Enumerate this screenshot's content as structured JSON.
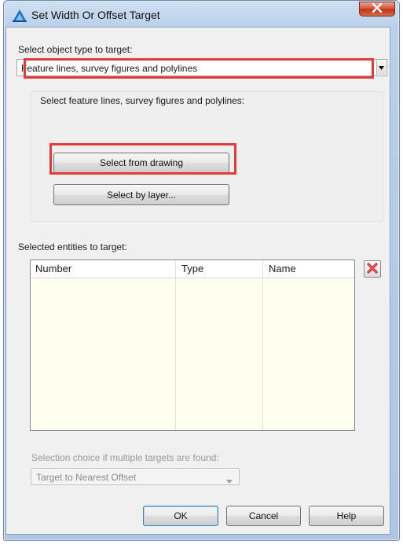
{
  "window": {
    "title": "Set Width Or Offset Target",
    "close_icon": "close-icon"
  },
  "object_type": {
    "label": "Select object type to target:",
    "selected": "Feature lines, survey figures and polylines"
  },
  "selection_group": {
    "label": "Select feature lines, survey figures and polylines:",
    "select_from_drawing": "Select from drawing",
    "select_by_layer": "Select by layer..."
  },
  "entities": {
    "label": "Selected entities to target:",
    "columns": [
      "Number",
      "Type",
      "Name"
    ],
    "rows": [],
    "delete_icon": "delete-icon"
  },
  "multiple_targets": {
    "label": "Selection choice if multiple targets are found:",
    "selected": "Target to Nearest Offset",
    "enabled": false
  },
  "buttons": {
    "ok": "OK",
    "cancel": "Cancel",
    "help": "Help"
  },
  "colors": {
    "highlight": "#e03c3c",
    "list_background": "#fffff0",
    "title_bar": "#b9d0ea",
    "close_button": "#c9452a"
  }
}
